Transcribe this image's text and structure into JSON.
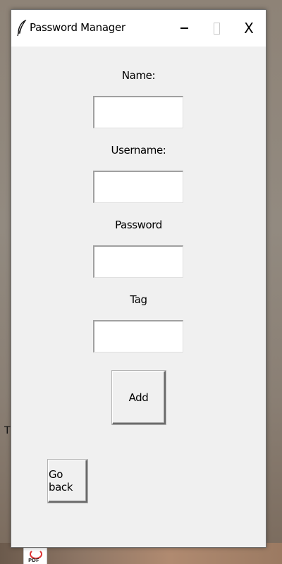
{
  "window": {
    "title": "Password Manager",
    "close_glyph": "X"
  },
  "form": {
    "name_label": "Name:",
    "username_label": "Username:",
    "password_label": "Password",
    "tag_label": "Tag",
    "name_value": "",
    "username_value": "",
    "password_value": "",
    "tag_value": ""
  },
  "buttons": {
    "add_label": "Add",
    "back_label": "Go back"
  },
  "background": {
    "stray_text": "Tl",
    "pdf_icon_text": "PDF"
  },
  "icons": {
    "app_icon": "feather-icon",
    "minimize": "minimize-icon",
    "maximize": "maximize-icon",
    "close": "close-icon",
    "desktop_file": "pdf-file-icon"
  }
}
